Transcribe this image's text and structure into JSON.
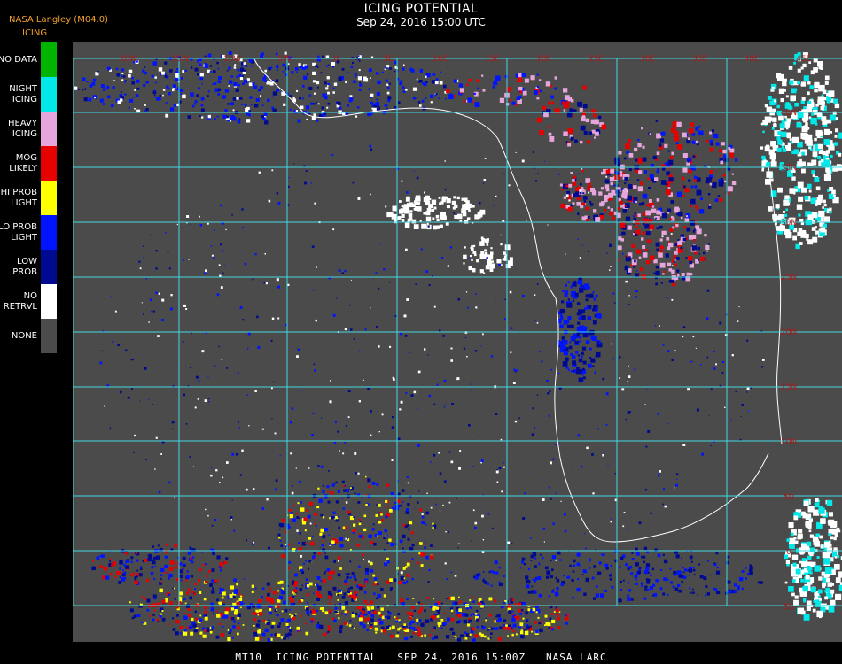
{
  "header": {
    "org": "NASA Langley (M04.0)",
    "legend_title": "ICING",
    "title": "ICING POTENTIAL",
    "datetime": "Sep 24, 2016 15:00 UTC"
  },
  "legend": [
    {
      "label": "NO DATA",
      "color": "#00b400"
    },
    {
      "label": "NIGHT\nICING",
      "color": "#00e8e8"
    },
    {
      "label": "HEAVY\nICING",
      "color": "#e6a6dc"
    },
    {
      "label": "MOG\nLIKELY",
      "color": "#e60000"
    },
    {
      "label": "HI PROB\nLIGHT",
      "color": "#ffff00"
    },
    {
      "label": "LO PROB\nLIGHT",
      "color": "#0014ff"
    },
    {
      "label": "LOW\nPROB",
      "color": "#000a90"
    },
    {
      "label": "NO\nRETRVL",
      "color": "#ffffff"
    },
    {
      "label": "NONE",
      "color": "#4b4b4b"
    }
  ],
  "map": {
    "background": "#4b4b4b",
    "grid_color": "#40d8e0",
    "label_color": "#b01818",
    "top_labels": [
      "20W",
      "15W",
      "10W",
      "5W",
      "0",
      "5E",
      "10E",
      "15E",
      "20E",
      "25E",
      "30E",
      "35E",
      "40E",
      "45E"
    ],
    "right_labels": [
      "40N",
      "35N",
      "30N",
      "25N",
      "20N",
      "15N",
      "10N",
      "5N",
      "0",
      "5S",
      "10S"
    ]
  },
  "footer": {
    "text": "MT10  ICING POTENTIAL   SEP 24, 2016 15:00Z   NASA LARC"
  }
}
